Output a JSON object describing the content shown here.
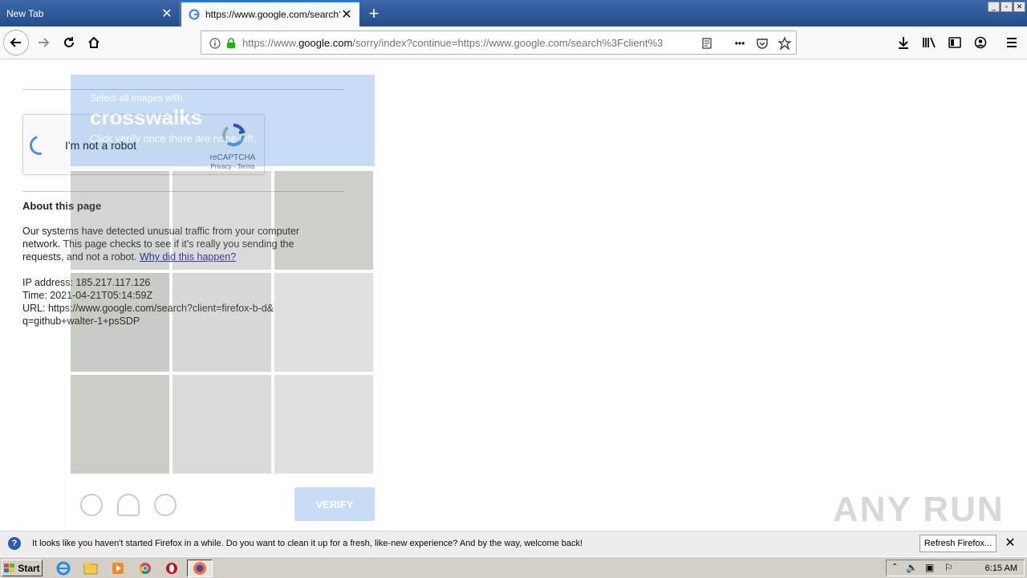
{
  "tabs": [
    {
      "label": "New Tab"
    },
    {
      "label": "https://www.google.com/search?client=firefox-b-d&q=github"
    }
  ],
  "url": {
    "prefix": "https://www.",
    "host": "google.com",
    "path": "/sorry/index?continue=https://www.google.com/search%3Fclient%3"
  },
  "recaptcha": {
    "label": "I'm not a robot",
    "brand": "reCAPTCHA",
    "links": "Privacy - Terms"
  },
  "challenge": {
    "subtitle": "Select all images with",
    "keyword": "crosswalks",
    "hint": "Click verify once there are none left.",
    "verify_label": "VERIFY"
  },
  "about": {
    "title": "About this page",
    "text": "Our systems have detected unusual traffic from your computer network. This page checks to see if it's really you sending the requests, and not a robot.",
    "link": "Why did this happen?",
    "ip": "IP address: 185.217.117.126",
    "time": "Time: 2021-04-21T05:14:59Z",
    "url_line1": "URL: https://www.google.com/search?client=firefox-b-d&",
    "url_line2": "q=github+walter-1+psSDP"
  },
  "watermark": "ANY RUN",
  "notification": {
    "text": "It looks like you haven't started Firefox in a while. Do you want to clean it up for a fresh, like-new experience? And by the way, welcome back!",
    "button": "Refresh Firefox..."
  },
  "taskbar": {
    "start": "Start",
    "clock": "6:15 AM"
  }
}
